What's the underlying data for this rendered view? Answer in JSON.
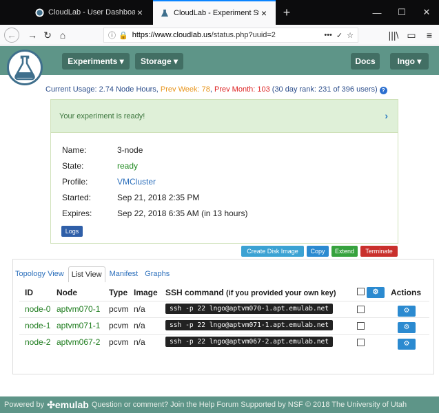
{
  "browser": {
    "tabs": [
      {
        "title": "CloudLab - User Dashboard",
        "active": false
      },
      {
        "title": "CloudLab - Experiment Status",
        "active": true
      }
    ],
    "new_tab": "+",
    "win_min": "—",
    "win_max": "☐",
    "win_close": "✕",
    "url_host": "https://www.cloudlab.us",
    "url_path": "/status.php?uuid=2",
    "url_fade": "",
    "menu_dots": "•••",
    "pocket": "✓",
    "star": "☆",
    "library": "|||\\",
    "sidebar": "▭",
    "hamburger": "≡"
  },
  "appnav": {
    "experiments": "Experiments ▾",
    "storage": "Storage ▾",
    "docs": "Docs",
    "user": "Ingo ▾"
  },
  "usage": {
    "current": "Current Usage: 2.74 Node Hours, ",
    "prev_week": "Prev Week: 78",
    "sep": ", ",
    "prev_month": "Prev Month: 103",
    "rank": " (30 day rank: 231 of 396 users)",
    "help": "?"
  },
  "status": {
    "ready_msg": "Your experiment is ready!",
    "chevron": "›",
    "rows": [
      {
        "label": "Name:",
        "value": "3-node"
      },
      {
        "label": "State:",
        "value": "ready"
      },
      {
        "label": "Profile:",
        "value": "VMCluster"
      },
      {
        "label": "Started:",
        "value": "Sep 21, 2018 2:35 PM"
      },
      {
        "label": "Expires:",
        "value": "Sep 22, 2018 6:35 AM (in 13 hours)"
      }
    ],
    "logs": "Logs"
  },
  "actions": {
    "disk_image": "Create Disk Image",
    "copy": "Copy",
    "extend": "Extend",
    "terminate": "Terminate"
  },
  "colors": {
    "disk_image": "#3ba2d3",
    "copy": "#2b8ad0",
    "extend": "#36a23d",
    "terminate": "#c9302c"
  },
  "views": {
    "tabs": [
      "Topology View",
      "List View",
      "Manifest",
      "Graphs"
    ]
  },
  "table": {
    "headers": {
      "id": "ID",
      "node": "Node",
      "type": "Type",
      "image": "Image",
      "ssh": "SSH command",
      "ssh_note": "(if you provided your own key)",
      "actions": "Actions"
    },
    "rows": [
      {
        "id": "node-0",
        "node": "aptvm070-1",
        "type": "pcvm",
        "image": "n/a",
        "ssh": "ssh -p 22 lngo@aptvm070-1.apt.emulab.net"
      },
      {
        "id": "node-1",
        "node": "aptvm071-1",
        "type": "pcvm",
        "image": "n/a",
        "ssh": "ssh -p 22 lngo@aptvm071-1.apt.emulab.net"
      },
      {
        "id": "node-2",
        "node": "aptvm067-2",
        "type": "pcvm",
        "image": "n/a",
        "ssh": "ssh -p 22 lngo@aptvm067-2.apt.emulab.net"
      }
    ],
    "gear": "⚙"
  },
  "footer": {
    "powered": "Powered by",
    "brand": "emulab",
    "rest": "Question or comment? Join the Help Forum  Supported by NSF   © 2018 The University of Utah"
  }
}
